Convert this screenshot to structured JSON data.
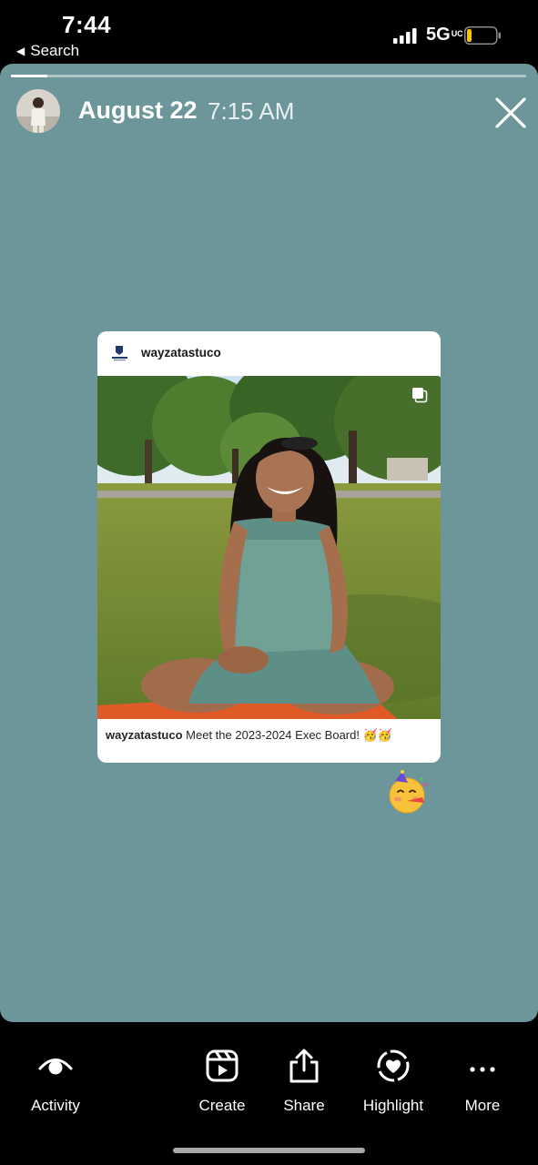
{
  "status_bar": {
    "time": "7:44",
    "back_label": "Search",
    "network": "5G",
    "network_suffix": "UC",
    "battery_color": "#f5c400"
  },
  "story": {
    "background_color": "#6d969b",
    "progress": 0.07,
    "date": "August 22",
    "time": "7:15 AM",
    "close_icon": "close-icon"
  },
  "shared_post": {
    "username": "wayzatastuco",
    "caption_user": "wayzatastuco",
    "caption_text": "Meet the 2023-2024 Exec Board! 🥳🥳",
    "has_multiple_images": true
  },
  "sticker": {
    "emoji": "🥳"
  },
  "actions": [
    {
      "label": "Activity",
      "icon": "eye-icon"
    },
    {
      "label": "Create",
      "icon": "reels-icon"
    },
    {
      "label": "Share",
      "icon": "share-icon"
    },
    {
      "label": "Highlight",
      "icon": "highlight-heart-icon"
    },
    {
      "label": "More",
      "icon": "more-icon"
    }
  ]
}
